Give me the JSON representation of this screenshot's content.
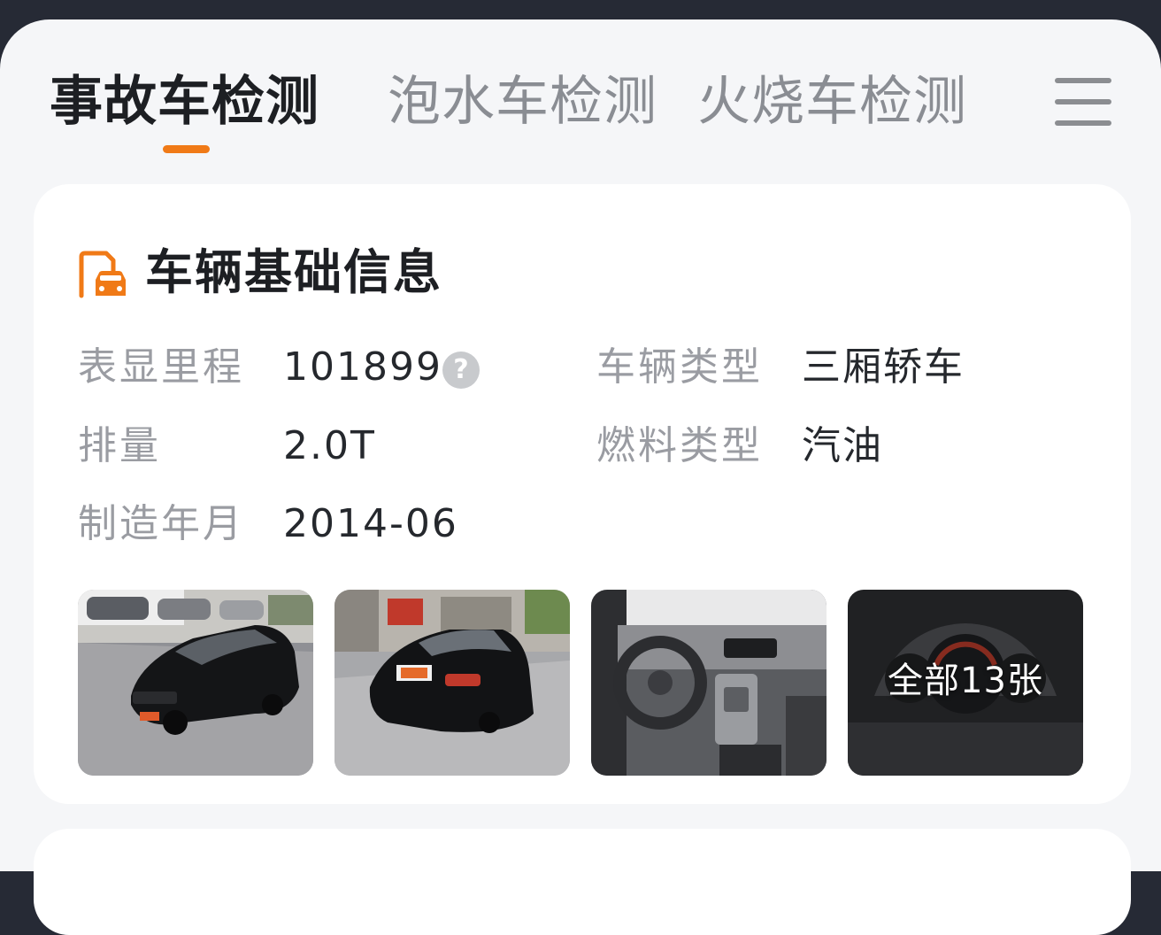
{
  "tabs": [
    {
      "label": "事故车检测",
      "active": true
    },
    {
      "label": "泡水车检测",
      "active": false
    },
    {
      "label": "火烧车检测",
      "active": false
    }
  ],
  "menu_icon": "hamburger-menu-icon",
  "accent_color": "#f07a17",
  "card": {
    "icon": "car-document-icon",
    "title": "车辆基础信息",
    "info": {
      "mileage_label": "表显里程",
      "mileage_value": "101899",
      "vehicle_type_label": "车辆类型",
      "vehicle_type_value": "三厢轿车",
      "displacement_label": "排量",
      "displacement_value": "2.0T",
      "fuel_type_label": "燃料类型",
      "fuel_type_value": "汽油",
      "manufacture_date_label": "制造年月",
      "manufacture_date_value": "2014-06"
    },
    "help_icon_glyph": "?",
    "photos": {
      "items": [
        {
          "subject": "car-front-left-photo"
        },
        {
          "subject": "car-rear-photo"
        },
        {
          "subject": "car-interior-photo"
        },
        {
          "subject": "instrument-cluster-photo"
        }
      ],
      "all_label": "全部13张"
    }
  }
}
